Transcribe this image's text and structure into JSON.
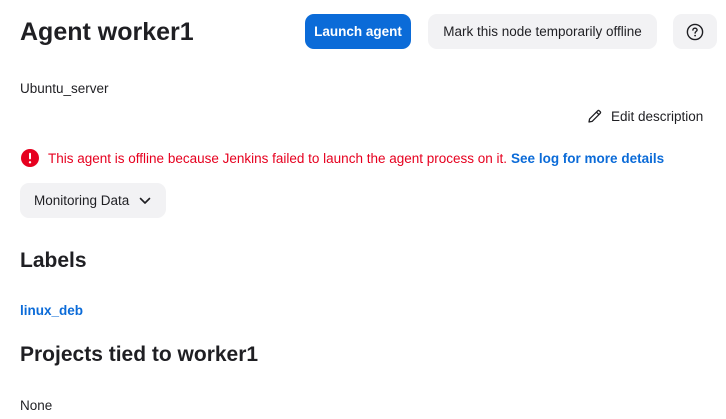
{
  "header": {
    "title": "Agent worker1",
    "launch_label": "Launch agent",
    "offline_label": "Mark this node temporarily offline",
    "help_icon": "help-circle-icon"
  },
  "description": {
    "text": "Ubuntu_server",
    "edit_label": "Edit description",
    "edit_icon": "pencil-icon"
  },
  "status": {
    "message": "This agent is offline because Jenkins failed to launch the agent process on it.",
    "link_label": "See log for more details",
    "icon": "error-icon",
    "error_color": "#e6001f",
    "link_color": "#0b6bd8"
  },
  "monitoring": {
    "label": "Monitoring Data",
    "icon": "chevron-down-icon"
  },
  "labels": {
    "heading": "Labels",
    "items": [
      "linux_deb"
    ]
  },
  "projects": {
    "heading": "Projects tied to worker1",
    "empty_text": "None"
  },
  "colors": {
    "accent": "#0b6bd8",
    "button_bg": "#f2f2f4",
    "text": "#1f1f23"
  }
}
